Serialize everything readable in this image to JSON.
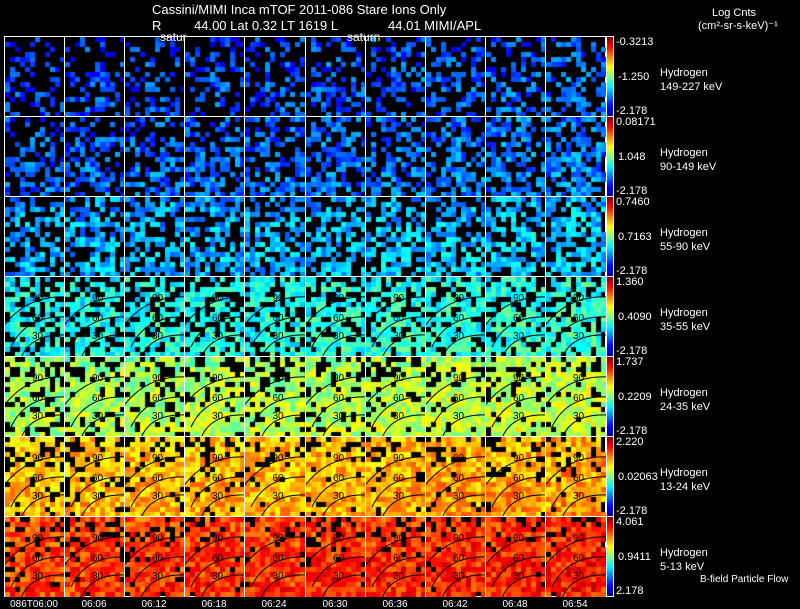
{
  "header": {
    "line1": "Cassini/MIMI Inca mTOF  2011-086   Stare   Ions Only",
    "line2_r": "R",
    "line2": "44.00 Lat 0.32 LT 1619 L",
    "line2_l": "44.01   MIMI/APL",
    "overlay_1": "satur",
    "overlay_2": "saturn"
  },
  "colorbar_title": {
    "line1": "Log Cnts",
    "line2": "(cm²-sr-s-keV)⁻¹"
  },
  "footer_note": "B-field Particle Flow",
  "chart_data": {
    "type": "heatmap",
    "colormap": "jet",
    "x_tick_labels": [
      "086T06:00",
      "06:06",
      "06:12",
      "06:18",
      "06:24",
      "06:30",
      "06:36",
      "06:42",
      "06:48",
      "06:54"
    ],
    "contour_labels": [
      "90",
      "60",
      "30"
    ],
    "rows": [
      {
        "species": "Hydrogen",
        "energy": "149-227 keV",
        "max": "-0.3213",
        "mid": "-1.250",
        "min": "-2.178",
        "level": 0.15,
        "fill": 0.35
      },
      {
        "species": "Hydrogen",
        "energy": "90-149 keV",
        "max": "0.08171",
        "mid": "1.048",
        "min": "-2.178",
        "level": 0.18,
        "fill": 0.5
      },
      {
        "species": "Hydrogen",
        "energy": "55-90 keV",
        "max": "0.7460",
        "mid": "0.7163",
        "min": "-2.178",
        "level": 0.25,
        "fill": 0.55
      },
      {
        "species": "Hydrogen",
        "energy": "35-55 keV",
        "max": "1.360",
        "mid": "0.4090",
        "min": "-2.178",
        "level": 0.35,
        "fill": 0.65
      },
      {
        "species": "Hydrogen",
        "energy": "24-35 keV",
        "max": "1.737",
        "mid": "0.2209",
        "min": "-2.178",
        "level": 0.5,
        "fill": 0.75
      },
      {
        "species": "Hydrogen",
        "energy": "13-24 keV",
        "max": "2.220",
        "mid": "0.02063",
        "min": "-2.178",
        "level": 0.65,
        "fill": 0.82
      },
      {
        "species": "Hydrogen",
        "energy": "5-13 keV",
        "max": "4.061",
        "mid": "0.9411",
        "min": "2.178",
        "level": 0.78,
        "fill": 0.88
      }
    ]
  }
}
